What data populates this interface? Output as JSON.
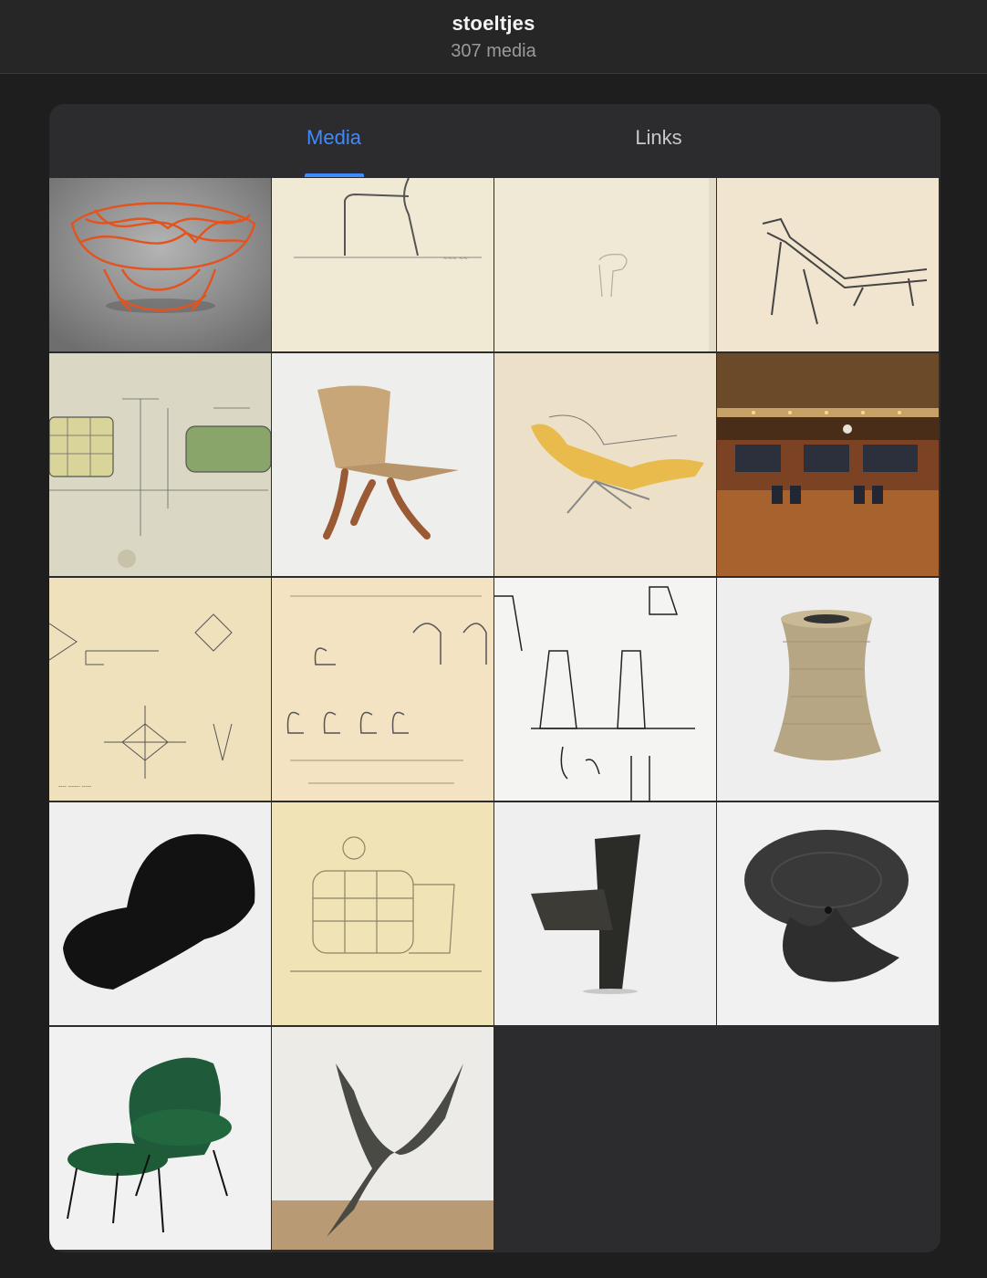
{
  "header": {
    "title": "stoeltjes",
    "subtitle": "307 media"
  },
  "tabs": [
    {
      "label": "Media",
      "active": true
    },
    {
      "label": "Links",
      "active": false
    }
  ],
  "colors": {
    "accent": "#3d8bff",
    "background": "#1e1e1e",
    "panel": "#2c2c2e"
  },
  "media_count_shown": 18
}
